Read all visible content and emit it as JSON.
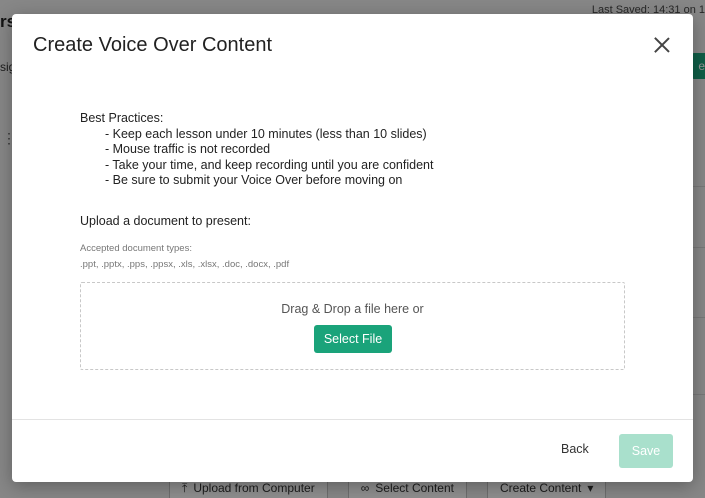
{
  "background": {
    "title_fragment": "rs",
    "subtitle_fragment": "sig",
    "last_saved": "Last Saved: 14:31 on 1",
    "green_button_fragment": "e",
    "toolbar": {
      "upload_label": "Upload from Computer",
      "select_label": "Select Content",
      "create_label": "Create Content",
      "create_caret": "▾"
    }
  },
  "modal": {
    "title": "Create Voice Over Content",
    "practices": {
      "heading": "Best Practices:",
      "items": [
        "Keep each lesson under 10 minutes (less than 10 slides)",
        "Mouse traffic is not recorded",
        "Take your time, and keep recording until you are confident",
        "Be sure to submit your Voice Over before moving on"
      ]
    },
    "upload_label": "Upload a document to present:",
    "accepted_heading": "Accepted document types:",
    "accepted_types": ".ppt, .pptx, .pps, .ppsx, .xls, .xlsx, .doc, .docx, .pdf",
    "dropzone_text": "Drag & Drop a file here or",
    "select_file_label": "Select File",
    "back_label": "Back",
    "save_label": "Save"
  },
  "colors": {
    "accent": "#1aa37a",
    "accent_disabled": "#a9e0cc"
  }
}
